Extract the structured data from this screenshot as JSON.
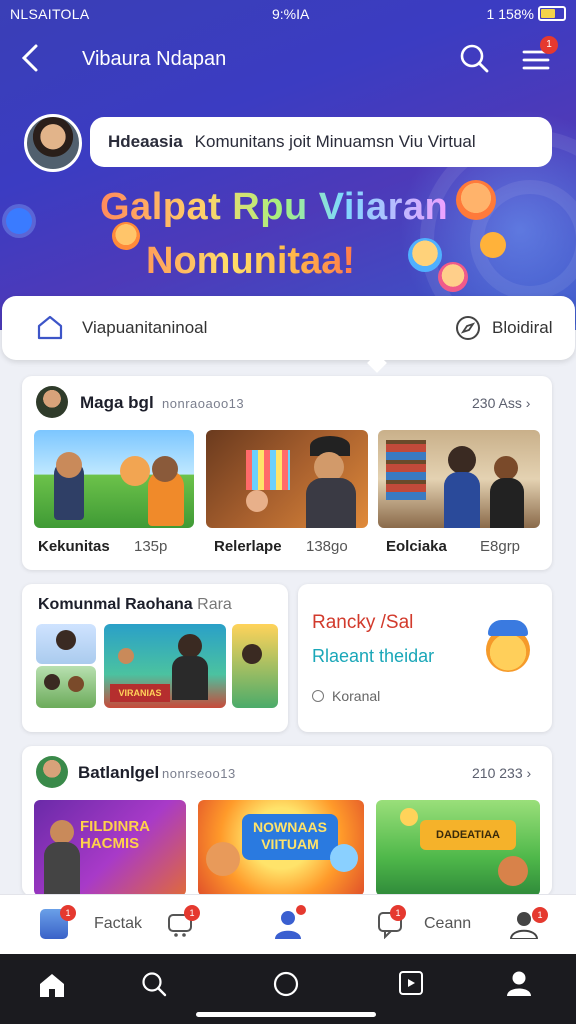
{
  "status": {
    "carrier": "NLSAITOLA",
    "time": "9:%IA",
    "battery_text": "1 158%"
  },
  "header": {
    "title": "Vibaura Ndapan",
    "notif_badge": "1"
  },
  "profile": {
    "name": "Hdeaasia",
    "caption": "Komunitans joit Minuamsn Viu Virtual"
  },
  "hero": {
    "headline_line1": "Galpat Rpu Viiaran",
    "headline_line2": "Nomunitaa!"
  },
  "community_bar": {
    "left_label": "Viapuanitaninoal",
    "right_label": "Bloidiral"
  },
  "section1": {
    "title": "Maga bgl",
    "subtitle": "nonraoaoo13",
    "count": "230 Ass",
    "items": [
      {
        "caption": "Kekunitas",
        "num": "135p"
      },
      {
        "caption": "Relerlape",
        "num": "138go"
      },
      {
        "caption": "Eolciaka",
        "num": "E8grp"
      }
    ]
  },
  "section2": {
    "title": "Komunmal Raohana",
    "title_suffix": "Rara",
    "banner_text": "VIRANIAS"
  },
  "promo": {
    "title": "Rancky /Sal",
    "subtitle": "Rlaeant theidar",
    "meta": "Koranal"
  },
  "section3": {
    "title": "Batlanlgel",
    "subtitle": "nonrseoo13",
    "count": "210 233",
    "items": [
      {
        "caption": "FILDINRA HACMIS"
      },
      {
        "caption": "NOWNAAS VIITUAM"
      },
      {
        "caption": "DADEATIAA"
      }
    ]
  },
  "bottom_nav": {
    "items": [
      {
        "label": "Factak",
        "badge": "1"
      },
      {
        "label": "",
        "badge": "1"
      },
      {
        "label": ""
      },
      {
        "label": "",
        "badge": "1"
      },
      {
        "label": "Ceann",
        "badge": "1"
      }
    ]
  },
  "colors": {
    "accent": "#3a3fb6",
    "badge": "#e5392f",
    "promo_title": "#d23a2c",
    "promo_subtitle": "#1aa7b8"
  }
}
